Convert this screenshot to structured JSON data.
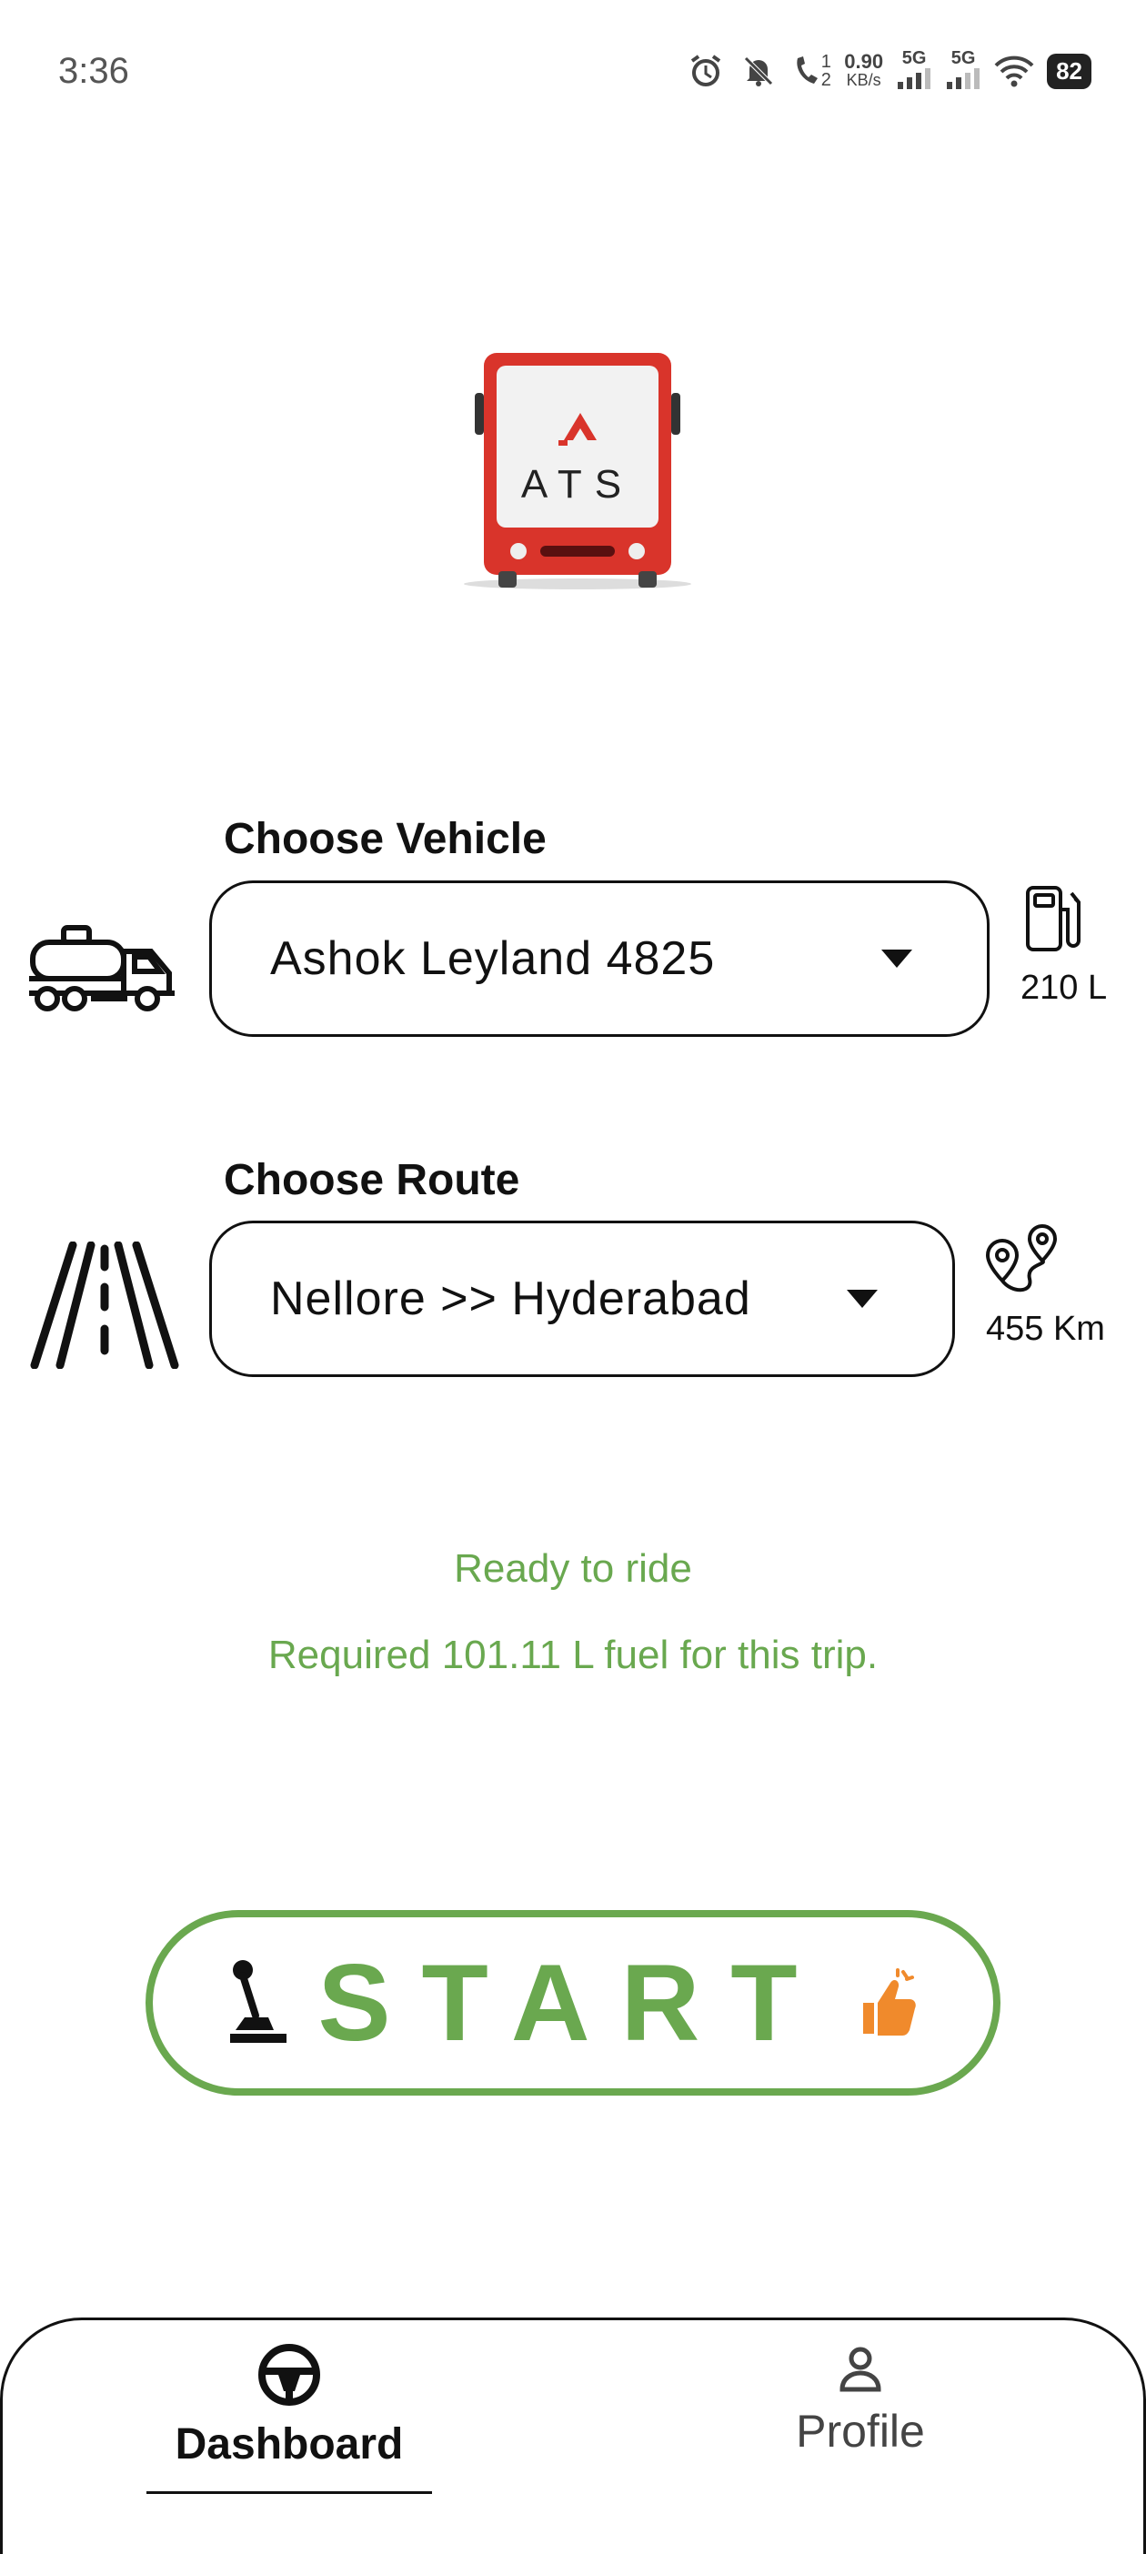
{
  "status_bar": {
    "time": "3:36",
    "speed_value": "0.90",
    "speed_unit": "KB/s",
    "call_top": "1",
    "call_bottom": "2",
    "net1": "5G",
    "net2": "5G",
    "battery": "82"
  },
  "logo": {
    "text": "ATS",
    "brand_color": "#d9342b"
  },
  "vehicle": {
    "label": "Choose Vehicle",
    "selected": "Ashok Leyland 4825",
    "fuel_capacity": "210 L"
  },
  "route": {
    "label": "Choose Route",
    "selected": "Nellore >> Hyderabad",
    "distance": "455 Km"
  },
  "messages": {
    "status": "Ready to ride",
    "fuel_required": "Required 101.11 L fuel for this trip."
  },
  "start_button": {
    "label": "START",
    "accent_color": "#6aa84f",
    "thumb_color": "#f08a2c"
  },
  "bottom_nav": {
    "items": [
      {
        "label": "Dashboard",
        "icon": "steering-wheel-icon",
        "active": true
      },
      {
        "label": "Profile",
        "icon": "person-icon",
        "active": false
      }
    ]
  }
}
